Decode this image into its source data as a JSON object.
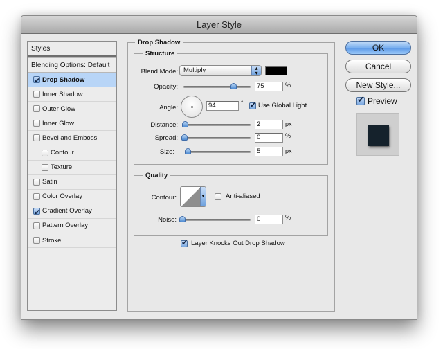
{
  "window": {
    "title": "Layer Style"
  },
  "sidebar": {
    "header": "Styles",
    "blending_options": "Blending Options: Default",
    "items": [
      {
        "label": "Drop Shadow",
        "checked": true,
        "selected": true,
        "indent": false
      },
      {
        "label": "Inner Shadow",
        "checked": false,
        "selected": false,
        "indent": false
      },
      {
        "label": "Outer Glow",
        "checked": false,
        "selected": false,
        "indent": false
      },
      {
        "label": "Inner Glow",
        "checked": false,
        "selected": false,
        "indent": false
      },
      {
        "label": "Bevel and Emboss",
        "checked": false,
        "selected": false,
        "indent": false
      },
      {
        "label": "Contour",
        "checked": false,
        "selected": false,
        "indent": true
      },
      {
        "label": "Texture",
        "checked": false,
        "selected": false,
        "indent": true
      },
      {
        "label": "Satin",
        "checked": false,
        "selected": false,
        "indent": false
      },
      {
        "label": "Color Overlay",
        "checked": false,
        "selected": false,
        "indent": false
      },
      {
        "label": "Gradient Overlay",
        "checked": true,
        "selected": false,
        "indent": false
      },
      {
        "label": "Pattern Overlay",
        "checked": false,
        "selected": false,
        "indent": false
      },
      {
        "label": "Stroke",
        "checked": false,
        "selected": false,
        "indent": false
      }
    ]
  },
  "drop_shadow": {
    "title": "Drop Shadow",
    "structure": {
      "title": "Structure",
      "blend_mode_label": "Blend Mode:",
      "blend_mode_value": "Multiply",
      "shadow_color": "#000000",
      "opacity_label": "Opacity:",
      "opacity_value": "75",
      "opacity_unit": "%",
      "opacity_fraction": 0.75,
      "angle_label": "Angle:",
      "angle_value": "94",
      "angle_unit": "°",
      "use_global_light_label": "Use Global Light",
      "use_global_light": true,
      "distance_label": "Distance:",
      "distance_value": "2",
      "distance_unit": "px",
      "spread_label": "Spread:",
      "spread_value": "0",
      "spread_unit": "%",
      "size_label": "Size:",
      "size_value": "5",
      "size_unit": "px"
    },
    "quality": {
      "title": "Quality",
      "contour_label": "Contour:",
      "anti_aliased_label": "Anti-aliased",
      "anti_aliased": false,
      "noise_label": "Noise:",
      "noise_value": "0",
      "noise_unit": "%"
    },
    "knockout_label": "Layer Knocks Out Drop Shadow",
    "knockout": true
  },
  "buttons": {
    "ok": "OK",
    "cancel": "Cancel",
    "new_style": "New Style...",
    "preview_label": "Preview",
    "preview_checked": true
  },
  "colors": {
    "selection": "#b8d5f7",
    "accent": "#5a97e6",
    "preview_swatch": "#15222c"
  }
}
